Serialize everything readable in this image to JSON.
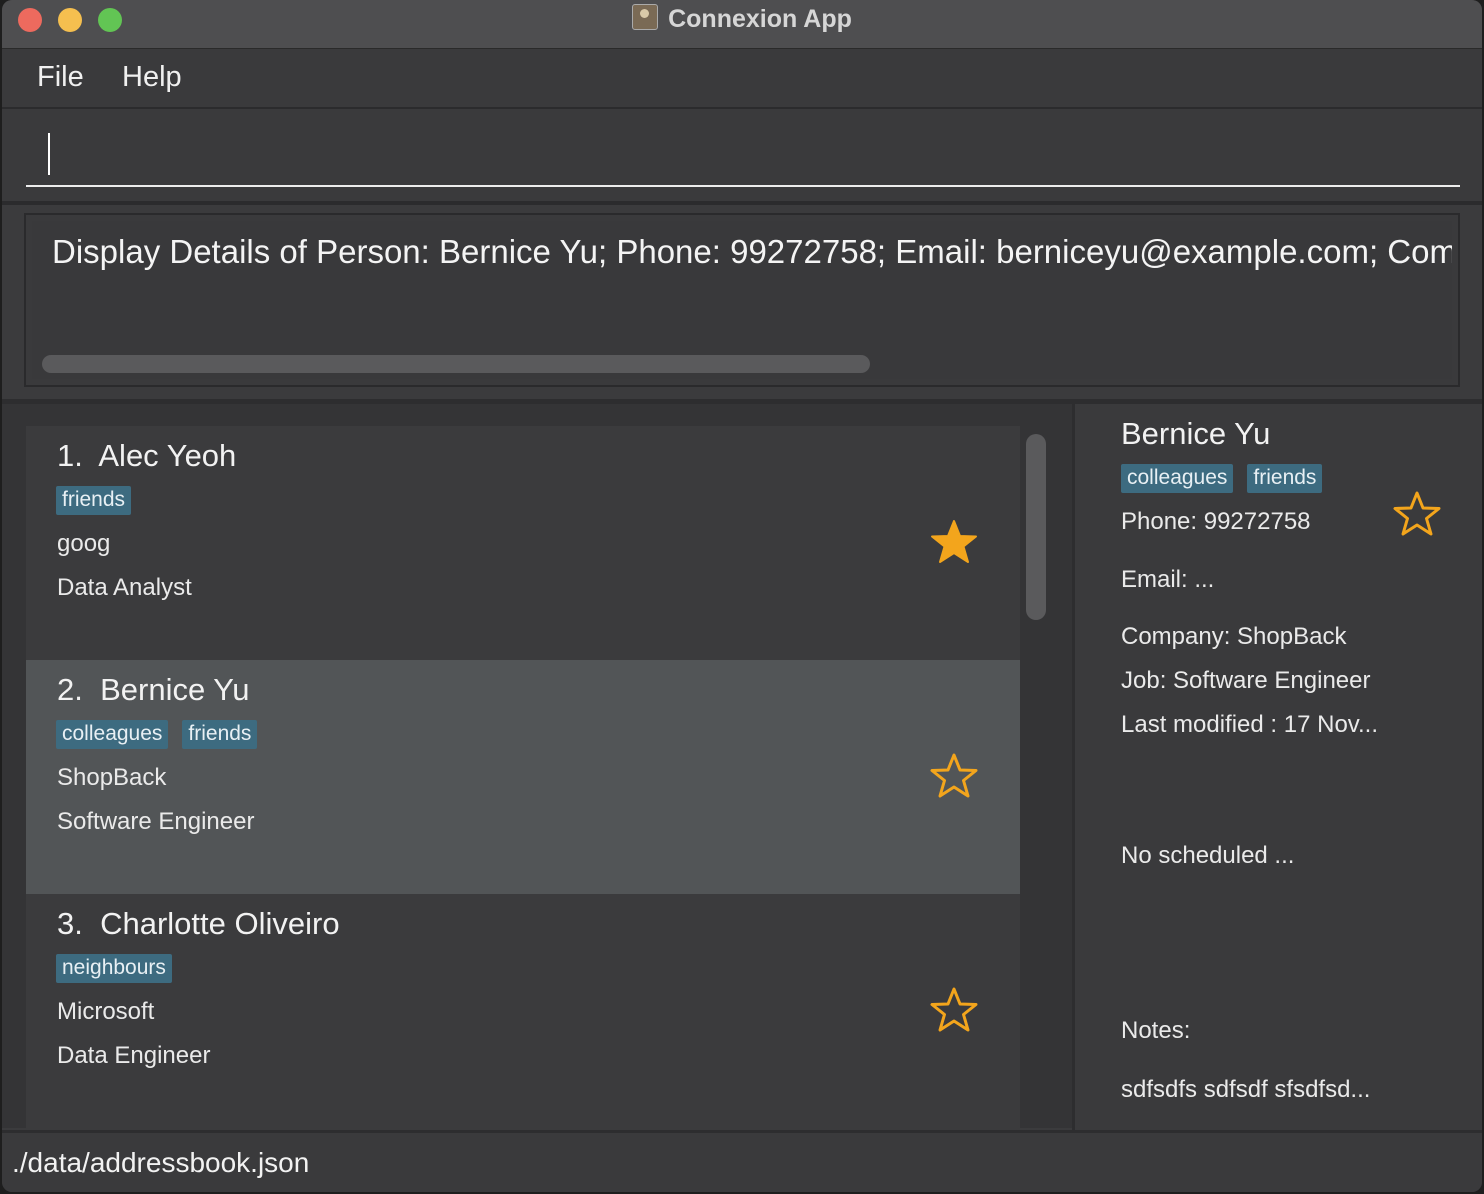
{
  "window": {
    "title": "Connexion App"
  },
  "menu": {
    "items": [
      "File",
      "Help"
    ]
  },
  "command": {
    "value": "",
    "placeholder": ""
  },
  "result": {
    "text": "Display Details of Person: Bernice Yu; Phone: 99272758; Email: berniceyu@example.com; Company: ShopBack; Job: Software Engineer"
  },
  "persons": [
    {
      "index": "1.",
      "name": "Alec Yeoh",
      "tags": [
        "friends"
      ],
      "company": "goog",
      "job": "Data Analyst",
      "bookmarked": true
    },
    {
      "index": "2.",
      "name": "Bernice Yu",
      "tags": [
        "colleagues",
        "friends"
      ],
      "company": "ShopBack",
      "job": "Software Engineer",
      "bookmarked": false
    },
    {
      "index": "3.",
      "name": "Charlotte Oliveiro",
      "tags": [
        "neighbours"
      ],
      "company": "Microsoft",
      "job": "Data Engineer",
      "bookmarked": false
    }
  ],
  "details": {
    "name": "Bernice Yu",
    "tags": [
      "colleagues",
      "friends"
    ],
    "phone": "Phone: 99272758",
    "email": "Email: ...",
    "company": "Company: ShopBack",
    "job": "Job: Software Engineer",
    "last_modified": "Last modified : 17 Nov...",
    "schedule": "No scheduled ...",
    "notes_label": "Notes:",
    "notes": "sdfsdfs sdfsdf sfsdfsd...",
    "bookmarked": false
  },
  "status": {
    "file_path": "./data/addressbook.json"
  },
  "colors": {
    "star": "#f3a51c",
    "tag_bg": "#3d6b80",
    "selected_card": "#525557"
  },
  "icons": {
    "star_filled": "star-filled-icon",
    "star_outline": "star-outline-icon",
    "app": "app-icon"
  }
}
